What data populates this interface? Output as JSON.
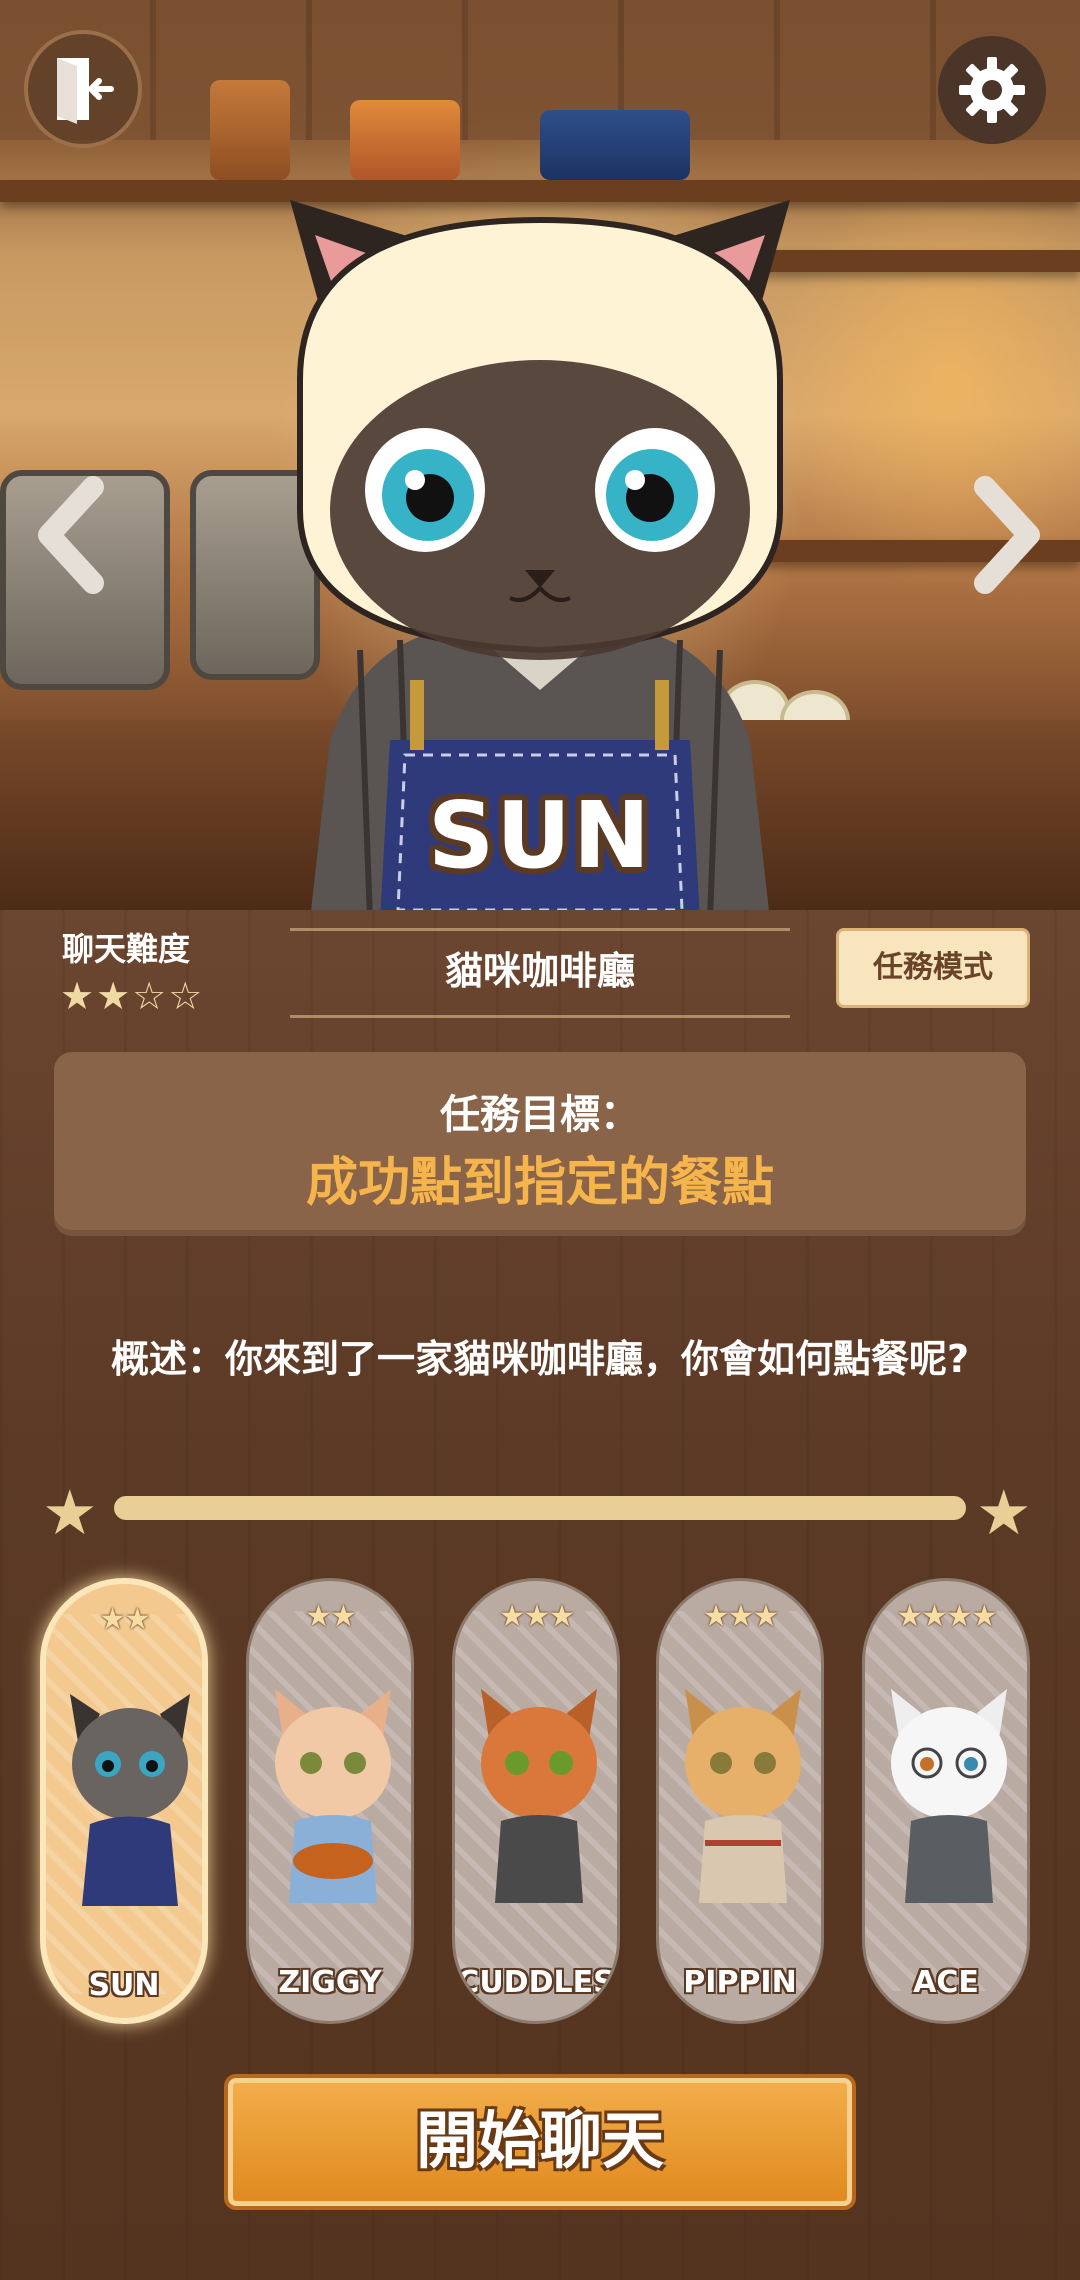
{
  "header": {
    "exit_icon": "door-exit-icon",
    "settings_icon": "gear-icon",
    "prev_icon": "chevron-left-icon",
    "next_icon": "chevron-right-icon"
  },
  "character": {
    "name": "SUN"
  },
  "info": {
    "difficulty_label": "聊天難度",
    "difficulty_stars": "★★☆☆",
    "difficulty_value": 2,
    "difficulty_max": 4,
    "scenario_title": "貓咪咖啡廳",
    "mode_button": "任務模式"
  },
  "goal": {
    "label": "任務目標：",
    "text": "成功點到指定的餐點"
  },
  "overview": "概述：你來到了一家貓咪咖啡廳，你會如何點餐呢?",
  "progress": {
    "value": 1.0
  },
  "cards": [
    {
      "name": "SUN",
      "stars": "★★",
      "selected": true
    },
    {
      "name": "ZIGGY",
      "stars": "★★",
      "selected": false
    },
    {
      "name": "CUDDLES",
      "stars": "★★★",
      "selected": false
    },
    {
      "name": "PIPPIN",
      "stars": "★★★",
      "selected": false
    },
    {
      "name": "ACE",
      "stars": "★★★★",
      "selected": false
    }
  ],
  "start_button": "開始聊天",
  "colors": {
    "accent_orange": "#f6b54c",
    "button_orange": "#e08a1f",
    "wood_dark": "#5c3a26",
    "cream": "#f8e4bd"
  }
}
